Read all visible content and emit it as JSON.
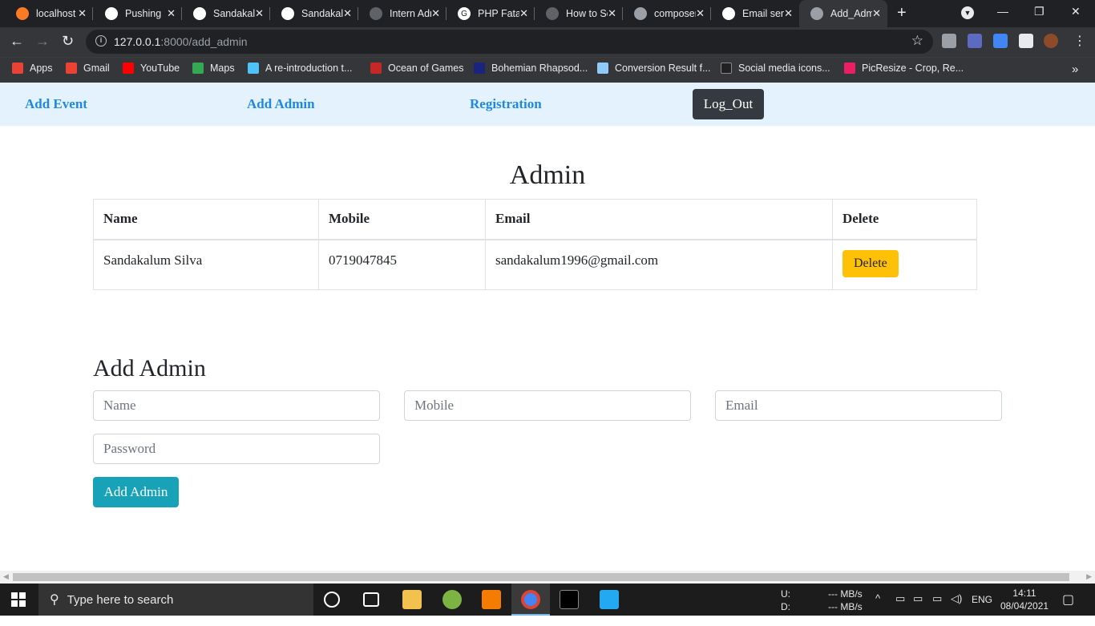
{
  "browser": {
    "tabs": [
      {
        "label": "localhost",
        "icon": "xampp-icon",
        "color": "#fb7a24"
      },
      {
        "label": "Pushing",
        "icon": "github-icon",
        "color": "#ffffff"
      },
      {
        "label": "Sandakalum",
        "icon": "github-icon",
        "color": "#ffffff"
      },
      {
        "label": "Sandakalum",
        "icon": "github-icon",
        "color": "#ffffff"
      },
      {
        "label": "Intern Admin",
        "icon": "globe-icon",
        "color": "#5f6368"
      },
      {
        "label": "PHP Fatal",
        "icon": "google-icon",
        "color": "#ffffff"
      },
      {
        "label": "How to Solve",
        "icon": "globe-icon",
        "color": "#5f6368"
      },
      {
        "label": "composer",
        "icon": "stackoverflow-icon",
        "color": "#9aa0a6"
      },
      {
        "label": "Email send",
        "icon": "github-icon",
        "color": "#ffffff"
      },
      {
        "label": "Add_Admin",
        "icon": "globe-icon",
        "color": "#9aa0a6"
      }
    ],
    "url_host": "127.0.0.1",
    "url_rest": ":8000/add_admin",
    "bookmarks": [
      {
        "label": "Apps",
        "color": "#ea4335"
      },
      {
        "label": "Gmail",
        "color": "#ea4335"
      },
      {
        "label": "YouTube",
        "color": "#ff0000"
      },
      {
        "label": "Maps",
        "color": "#34a853"
      },
      {
        "label": "A re-introduction t...",
        "color": "#4fc3f7"
      },
      {
        "label": "Ocean of Games",
        "color": "#c62828"
      },
      {
        "label": "Bohemian Rhapsod...",
        "color": "#1a237e"
      },
      {
        "label": "Conversion Result f...",
        "color": "#90caf9"
      },
      {
        "label": "Social media icons...",
        "color": "#212121"
      },
      {
        "label": "PicResize - Crop, Re...",
        "color": "#e91e63"
      }
    ],
    "more_bookmarks": "»"
  },
  "nav": {
    "add_event": "Add Event",
    "add_admin": "Add Admin",
    "registration": "Registration",
    "logout": "Log_Out"
  },
  "admin_section": {
    "title": "Admin",
    "columns": [
      "Name",
      "Mobile",
      "Email",
      "Delete"
    ],
    "rows": [
      {
        "name": "Sandakalum Silva",
        "mobile": "0719047845",
        "email": "sandakalum1996@gmail.com",
        "delete_label": "Delete"
      }
    ]
  },
  "add_admin_form": {
    "title": "Add Admin",
    "name_placeholder": "Name",
    "mobile_placeholder": "Mobile",
    "email_placeholder": "Email",
    "password_placeholder": "Password",
    "submit_label": "Add Admin"
  },
  "taskbar": {
    "search_placeholder": "Type here to search",
    "net_up_label": "U:",
    "net_down_label": "D:",
    "net_up_value": "--- MB/s",
    "net_down_value": "--- MB/s",
    "language": "ENG",
    "time": "14:11",
    "date": "08/04/2021"
  },
  "colors": {
    "nav_bg": "#e3f2fd",
    "nav_link": "#1e88e5",
    "logout_bg": "#343a40",
    "delete_btn": "#ffc107",
    "submit_btn": "#17a2b8"
  }
}
